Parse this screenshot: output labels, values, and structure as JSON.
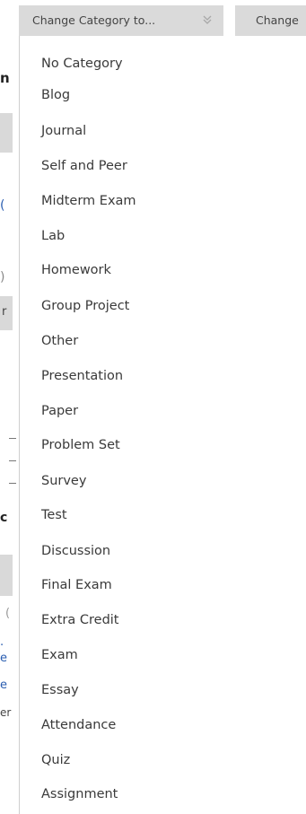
{
  "toolbar": {
    "change_category_label": "Change Category to...",
    "change_label": "Change"
  },
  "category_menu": {
    "items": [
      "No Category",
      "Blog",
      "Journal",
      "Self and Peer",
      "Midterm Exam",
      "Lab",
      "Homework",
      "Group Project",
      "Other",
      "Presentation",
      "Paper",
      "Problem Set",
      "Survey",
      "Test",
      "Discussion",
      "Final Exam",
      "Extra Credit",
      "Exam",
      "Essay",
      "Attendance",
      "Quiz",
      "Assignment"
    ]
  },
  "background": {
    "fragments": [
      "n",
      "(",
      ")",
      "r",
      "c",
      "(",
      "e",
      "e",
      "er"
    ]
  },
  "colors": {
    "toolbar_button_bg": "#dadada",
    "menu_text": "#3a3a3a",
    "chevron": "#999999"
  },
  "icons": {
    "dropdown_chevron": "double-chevron-down-icon"
  }
}
